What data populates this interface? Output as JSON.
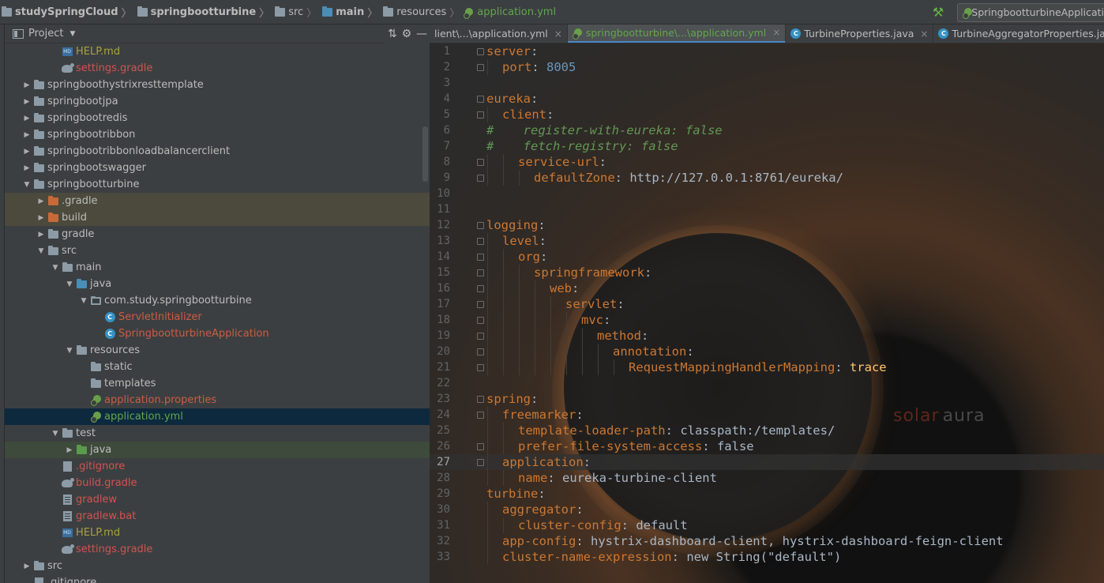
{
  "breadcrumb": [
    {
      "label": "studySpringCloud",
      "bold": true
    },
    {
      "label": "springbootturbine",
      "bold": true
    },
    {
      "label": "src",
      "bold": false
    },
    {
      "label": "main",
      "bold": true
    },
    {
      "label": "resources",
      "bold": false
    },
    {
      "label": "application.yml",
      "bold": false
    }
  ],
  "run_config": "SpringbootturbineApplicati",
  "project_panel": {
    "title": "Project"
  },
  "tree": [
    {
      "label": "HELP.md",
      "depth": 2,
      "icon": "md",
      "color": "olive",
      "arrow": ""
    },
    {
      "label": "settings.gradle",
      "depth": 2,
      "icon": "gradle",
      "color": "red",
      "arrow": ""
    },
    {
      "label": "springboothystrixresttemplate",
      "depth": 0,
      "icon": "folder",
      "color": "",
      "arrow": "right"
    },
    {
      "label": "springbootjpa",
      "depth": 0,
      "icon": "folder",
      "color": "",
      "arrow": "right"
    },
    {
      "label": "springbootredis",
      "depth": 0,
      "icon": "folder",
      "color": "",
      "arrow": "right"
    },
    {
      "label": "springbootribbon",
      "depth": 0,
      "icon": "folder",
      "color": "",
      "arrow": "right"
    },
    {
      "label": "springbootribbonloadbalancerclient",
      "depth": 0,
      "icon": "folder",
      "color": "",
      "arrow": "right"
    },
    {
      "label": "springbootswagger",
      "depth": 0,
      "icon": "folder",
      "color": "",
      "arrow": "right"
    },
    {
      "label": "springbootturbine",
      "depth": 0,
      "icon": "folder",
      "color": "",
      "arrow": "down"
    },
    {
      "label": ".gradle",
      "depth": 1,
      "icon": "folder-orange",
      "color": "",
      "arrow": "right",
      "hl": "orange"
    },
    {
      "label": "build",
      "depth": 1,
      "icon": "folder-orange",
      "color": "",
      "arrow": "right",
      "hl": "orange"
    },
    {
      "label": "gradle",
      "depth": 1,
      "icon": "folder",
      "color": "",
      "arrow": "right"
    },
    {
      "label": "src",
      "depth": 1,
      "icon": "folder",
      "color": "",
      "arrow": "down"
    },
    {
      "label": "main",
      "depth": 2,
      "icon": "folder",
      "color": "",
      "arrow": "down"
    },
    {
      "label": "java",
      "depth": 3,
      "icon": "folder-blue",
      "color": "",
      "arrow": "down"
    },
    {
      "label": "com.study.springbootturbine",
      "depth": 4,
      "icon": "package",
      "color": "",
      "arrow": "down"
    },
    {
      "label": "ServletInitializer",
      "depth": 5,
      "icon": "class",
      "color": "redorange",
      "arrow": ""
    },
    {
      "label": "SpringbootturbineApplication",
      "depth": 5,
      "icon": "class",
      "color": "redorange",
      "arrow": ""
    },
    {
      "label": "resources",
      "depth": 3,
      "icon": "folder-res",
      "color": "",
      "arrow": "down"
    },
    {
      "label": "static",
      "depth": 4,
      "icon": "folder",
      "color": "",
      "arrow": ""
    },
    {
      "label": "templates",
      "depth": 4,
      "icon": "folder",
      "color": "",
      "arrow": ""
    },
    {
      "label": "application.properties",
      "depth": 4,
      "icon": "yml",
      "color": "redorange",
      "arrow": ""
    },
    {
      "label": "application.yml",
      "depth": 4,
      "icon": "yml",
      "color": "green",
      "arrow": "",
      "hl": "selected"
    },
    {
      "label": "test",
      "depth": 2,
      "icon": "folder",
      "color": "",
      "arrow": "down"
    },
    {
      "label": "java",
      "depth": 3,
      "icon": "folder-green",
      "color": "",
      "arrow": "right",
      "hl": "green"
    },
    {
      "label": ".gitignore",
      "depth": 2,
      "icon": "git",
      "color": "red",
      "arrow": ""
    },
    {
      "label": "build.gradle",
      "depth": 2,
      "icon": "gradle",
      "color": "red",
      "arrow": ""
    },
    {
      "label": "gradlew",
      "depth": 2,
      "icon": "file",
      "color": "red",
      "arrow": ""
    },
    {
      "label": "gradlew.bat",
      "depth": 2,
      "icon": "file",
      "color": "red",
      "arrow": ""
    },
    {
      "label": "HELP.md",
      "depth": 2,
      "icon": "md",
      "color": "olive",
      "arrow": ""
    },
    {
      "label": "settings.gradle",
      "depth": 2,
      "icon": "gradle",
      "color": "red",
      "arrow": ""
    },
    {
      "label": "src",
      "depth": 0,
      "icon": "folder",
      "color": "",
      "arrow": "right"
    },
    {
      "label": ".gitignore",
      "depth": 0,
      "icon": "git",
      "color": "",
      "arrow": ""
    }
  ],
  "tabs": [
    {
      "label": "lient\\...\\application.yml",
      "active": false,
      "close": "×",
      "icon": "yml"
    },
    {
      "label": "springbootturbine\\...\\application.yml",
      "active": true,
      "close": "×",
      "icon": "yml"
    },
    {
      "label": "TurbineProperties.java",
      "active": false,
      "close": "×",
      "icon": "class"
    },
    {
      "label": "TurbineAggregatorProperties.java",
      "active": false,
      "close": "×",
      "icon": "class"
    }
  ],
  "editor": {
    "current_line": 27,
    "watermark": [
      "solar",
      "aura"
    ],
    "lines": [
      {
        "n": 1,
        "indent": 0,
        "key": "server",
        "sep": ":",
        "val": "",
        "vtype": ""
      },
      {
        "n": 2,
        "indent": 1,
        "key": "port",
        "sep": ": ",
        "val": "8005",
        "vtype": "num"
      },
      {
        "n": 3,
        "indent": 0,
        "key": "",
        "sep": "",
        "val": "",
        "vtype": ""
      },
      {
        "n": 4,
        "indent": 0,
        "key": "eureka",
        "sep": ":",
        "val": "",
        "vtype": ""
      },
      {
        "n": 5,
        "indent": 1,
        "key": "client",
        "sep": ":",
        "val": "",
        "vtype": ""
      },
      {
        "n": 6,
        "indent": 0,
        "comment": "#    register-with-eureka: false"
      },
      {
        "n": 7,
        "indent": 0,
        "comment": "#    fetch-registry: false"
      },
      {
        "n": 8,
        "indent": 2,
        "key": "service-url",
        "sep": ":",
        "val": "",
        "vtype": ""
      },
      {
        "n": 9,
        "indent": 3,
        "key": "defaultZone",
        "sep": ": ",
        "val": "http://127.0.0.1:8761/eureka/",
        "vtype": "str"
      },
      {
        "n": 10,
        "indent": 0,
        "key": "",
        "sep": "",
        "val": "",
        "vtype": ""
      },
      {
        "n": 11,
        "indent": 0,
        "key": "",
        "sep": "",
        "val": "",
        "vtype": ""
      },
      {
        "n": 12,
        "indent": 0,
        "key": "logging",
        "sep": ":",
        "val": "",
        "vtype": ""
      },
      {
        "n": 13,
        "indent": 1,
        "key": "level",
        "sep": ":",
        "val": "",
        "vtype": ""
      },
      {
        "n": 14,
        "indent": 2,
        "key": "org",
        "sep": ":",
        "val": "",
        "vtype": ""
      },
      {
        "n": 15,
        "indent": 3,
        "key": "springframework",
        "sep": ":",
        "val": "",
        "vtype": ""
      },
      {
        "n": 16,
        "indent": 4,
        "key": "web",
        "sep": ":",
        "val": "",
        "vtype": ""
      },
      {
        "n": 17,
        "indent": 5,
        "key": "servlet",
        "sep": ":",
        "val": "",
        "vtype": ""
      },
      {
        "n": 18,
        "indent": 6,
        "key": "mvc",
        "sep": ":",
        "val": "",
        "vtype": ""
      },
      {
        "n": 19,
        "indent": 7,
        "key": "method",
        "sep": ":",
        "val": "",
        "vtype": ""
      },
      {
        "n": 20,
        "indent": 8,
        "key": "annotation",
        "sep": ":",
        "val": "",
        "vtype": ""
      },
      {
        "n": 21,
        "indent": 9,
        "key": "RequestMappingHandlerMapping",
        "sep": ": ",
        "val": "trace",
        "vtype": "trace"
      },
      {
        "n": 22,
        "indent": 0,
        "key": "",
        "sep": "",
        "val": "",
        "vtype": ""
      },
      {
        "n": 23,
        "indent": 0,
        "key": "spring",
        "sep": ":",
        "val": "",
        "vtype": ""
      },
      {
        "n": 24,
        "indent": 1,
        "key": "freemarker",
        "sep": ":",
        "val": "",
        "vtype": ""
      },
      {
        "n": 25,
        "indent": 2,
        "key": "template-loader-path",
        "sep": ": ",
        "val": "classpath:/templates/",
        "vtype": "str"
      },
      {
        "n": 26,
        "indent": 2,
        "key": "prefer-file-system-access",
        "sep": ": ",
        "val": "false",
        "vtype": "str"
      },
      {
        "n": 27,
        "indent": 1,
        "key": "application",
        "sep": ":",
        "val": "",
        "vtype": ""
      },
      {
        "n": 28,
        "indent": 2,
        "key": "name",
        "sep": ": ",
        "val": "eureka-turbine-client",
        "vtype": "str"
      },
      {
        "n": 29,
        "indent": 0,
        "key": "turbine",
        "sep": ":",
        "val": "",
        "vtype": ""
      },
      {
        "n": 30,
        "indent": 1,
        "key": "aggregator",
        "sep": ":",
        "val": "",
        "vtype": ""
      },
      {
        "n": 31,
        "indent": 2,
        "key": "cluster-config",
        "sep": ": ",
        "val": "default",
        "vtype": "str"
      },
      {
        "n": 32,
        "indent": 1,
        "key": "app-config",
        "sep": ": ",
        "val": "hystrix-dashboard-client, hystrix-dashboard-feign-client",
        "vtype": "str"
      },
      {
        "n": 33,
        "indent": 1,
        "key": "cluster-name-expression",
        "sep": ": ",
        "val": "new String(\"default\")",
        "vtype": "str"
      }
    ]
  }
}
